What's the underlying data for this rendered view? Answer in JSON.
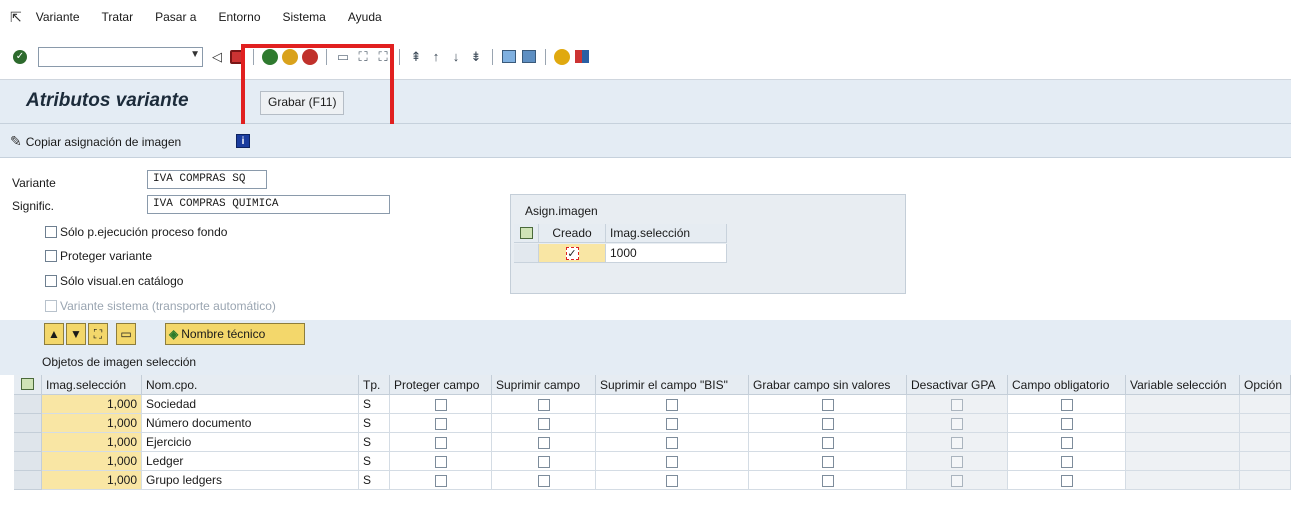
{
  "menu": {
    "items": [
      "Variante",
      "Tratar",
      "Pasar a",
      "Entorno",
      "Sistema",
      "Ayuda"
    ]
  },
  "toolbar": {
    "command_field_value": "",
    "tooltip": "Grabar  (F11)"
  },
  "page": {
    "title": "Atributos variante"
  },
  "app_toolbar": {
    "copy_label": "Copiar asignación de imagen"
  },
  "form": {
    "variant_label": "Variante",
    "variant_value": "IVA COMPRAS SQ",
    "meaning_label": "Signific.",
    "meaning_value": "IVA COMPRAS QUIMICA",
    "checkboxes": [
      {
        "label": "Sólo p.ejecución proceso fondo",
        "checked": false,
        "disabled": false
      },
      {
        "label": "Proteger variante",
        "checked": false,
        "disabled": false
      },
      {
        "label": "Sólo visual.en catálogo",
        "checked": false,
        "disabled": false
      },
      {
        "label": "Variante sistema (transporte automático)",
        "checked": false,
        "disabled": true
      }
    ]
  },
  "asign": {
    "title": "Asign.imagen",
    "col_created": "Creado",
    "col_screen": "Imag.selección",
    "row_created": true,
    "row_screen": "1000"
  },
  "grid": {
    "tech_name_button": "Nombre técnico",
    "caption": "Objetos de imagen selección",
    "columns": [
      "Imag.selección",
      "Nom.cpo.",
      "Tp.",
      "Proteger campo",
      "Suprimir campo",
      "Suprimir el campo \"BIS\"",
      "Grabar campo sin valores",
      "Desactivar GPA",
      "Campo obligatorio",
      "Variable selección",
      "Opción"
    ],
    "rows": [
      {
        "screen": "1,000",
        "field": "Sociedad",
        "type": "S"
      },
      {
        "screen": "1,000",
        "field": "Número documento",
        "type": "S"
      },
      {
        "screen": "1,000",
        "field": "Ejercicio",
        "type": "S"
      },
      {
        "screen": "1,000",
        "field": "Ledger",
        "type": "S"
      },
      {
        "screen": "1,000",
        "field": "Grupo ledgers",
        "type": "S"
      }
    ]
  },
  "colors": {
    "highlight": "#e12020",
    "title_bg": "#e4ecf4",
    "key_cell": "#f9e6a4",
    "button_yellow": "#f3d76b"
  }
}
